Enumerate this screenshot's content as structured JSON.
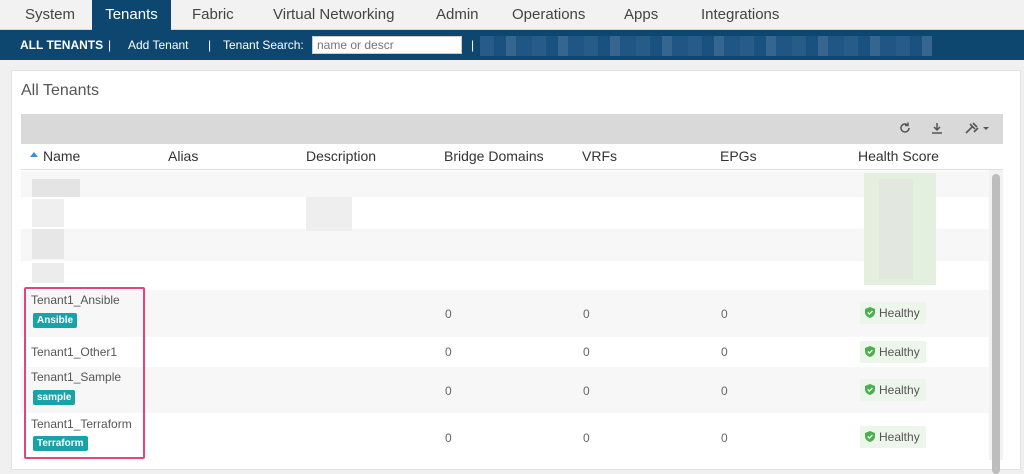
{
  "topnav": {
    "tabs": [
      {
        "label": "System"
      },
      {
        "label": "Tenants"
      },
      {
        "label": "Fabric"
      },
      {
        "label": "Virtual Networking"
      },
      {
        "label": "Admin"
      },
      {
        "label": "Operations"
      },
      {
        "label": "Apps"
      },
      {
        "label": "Integrations"
      }
    ],
    "active": "Tenants"
  },
  "subbar": {
    "all_tenants": "ALL TENANTS",
    "sep1": "|",
    "add_tenant": "Add Tenant",
    "sep2": "|",
    "search_label": "Tenant Search:",
    "search_placeholder": "name or descr",
    "sep3": "|"
  },
  "panel": {
    "title": "All Tenants"
  },
  "toolbar": {
    "refresh_icon": "refresh-icon",
    "download_icon": "download-icon",
    "tools_icon": "tools-icon"
  },
  "table": {
    "columns": [
      "Name",
      "Alias",
      "Description",
      "Bridge Domains",
      "VRFs",
      "EPGs",
      "Health Score"
    ],
    "rows": [
      {
        "name": "Tenant1_Ansible",
        "tag": "Ansible",
        "bridge_domains": "0",
        "vrfs": "0",
        "epgs": "0",
        "health": "Healthy"
      },
      {
        "name": "Tenant1_Other1",
        "tag": "",
        "bridge_domains": "0",
        "vrfs": "0",
        "epgs": "0",
        "health": "Healthy"
      },
      {
        "name": "Tenant1_Sample",
        "tag": "sample",
        "bridge_domains": "0",
        "vrfs": "0",
        "epgs": "0",
        "health": "Healthy"
      },
      {
        "name": "Tenant1_Terraform",
        "tag": "Terraform",
        "bridge_domains": "0",
        "vrfs": "0",
        "epgs": "0",
        "health": "Healthy"
      }
    ]
  },
  "colors": {
    "nav_dark": "#0d4770",
    "tag_teal": "#17a3a8",
    "health_green": "#4caf50",
    "highlight": "#e0457b"
  }
}
